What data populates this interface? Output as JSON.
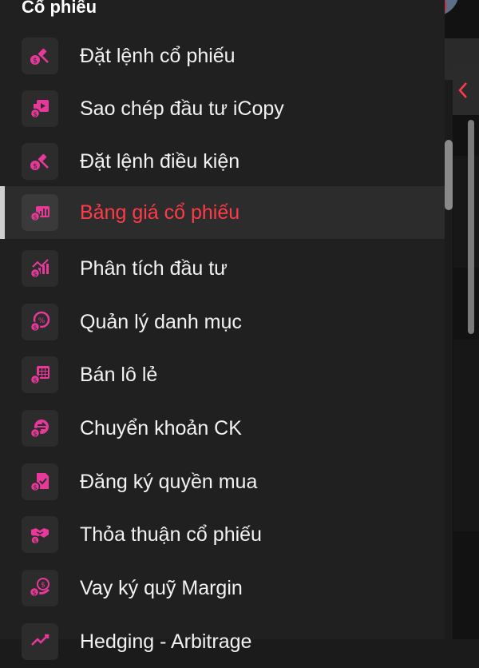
{
  "section_title": "Cổ phiếu",
  "accent": "#ff3b4a",
  "icon_color": "#e8399a",
  "menu": [
    {
      "label": "Đặt lệnh cổ phiếu",
      "icon": "gavel-icon",
      "active": false
    },
    {
      "label": "Sao chép đầu tư iCopy",
      "icon": "copy-play-icon",
      "active": false
    },
    {
      "label": "Đặt lệnh điều kiện",
      "icon": "gavel-icon",
      "active": false
    },
    {
      "label": "Bảng giá cổ phiếu",
      "icon": "price-board-icon",
      "active": true
    },
    {
      "label": "Phân tích đầu tư",
      "icon": "analysis-chart-icon",
      "active": false
    },
    {
      "label": "Quản lý danh mục",
      "icon": "portfolio-icon",
      "active": false
    },
    {
      "label": "Bán lô lẻ",
      "icon": "grid-icon",
      "active": false
    },
    {
      "label": "Chuyển khoản CK",
      "icon": "transfer-icon",
      "active": false
    },
    {
      "label": "Đăng ký quyền mua",
      "icon": "register-document-icon",
      "active": false
    },
    {
      "label": "Thỏa thuận cổ phiếu",
      "icon": "handshake-icon",
      "active": false
    },
    {
      "label": "Vay ký quỹ Margin",
      "icon": "margin-coins-icon",
      "active": false
    },
    {
      "label": "Hedging - Arbitrage",
      "icon": "hedging-icon",
      "active": false
    }
  ]
}
